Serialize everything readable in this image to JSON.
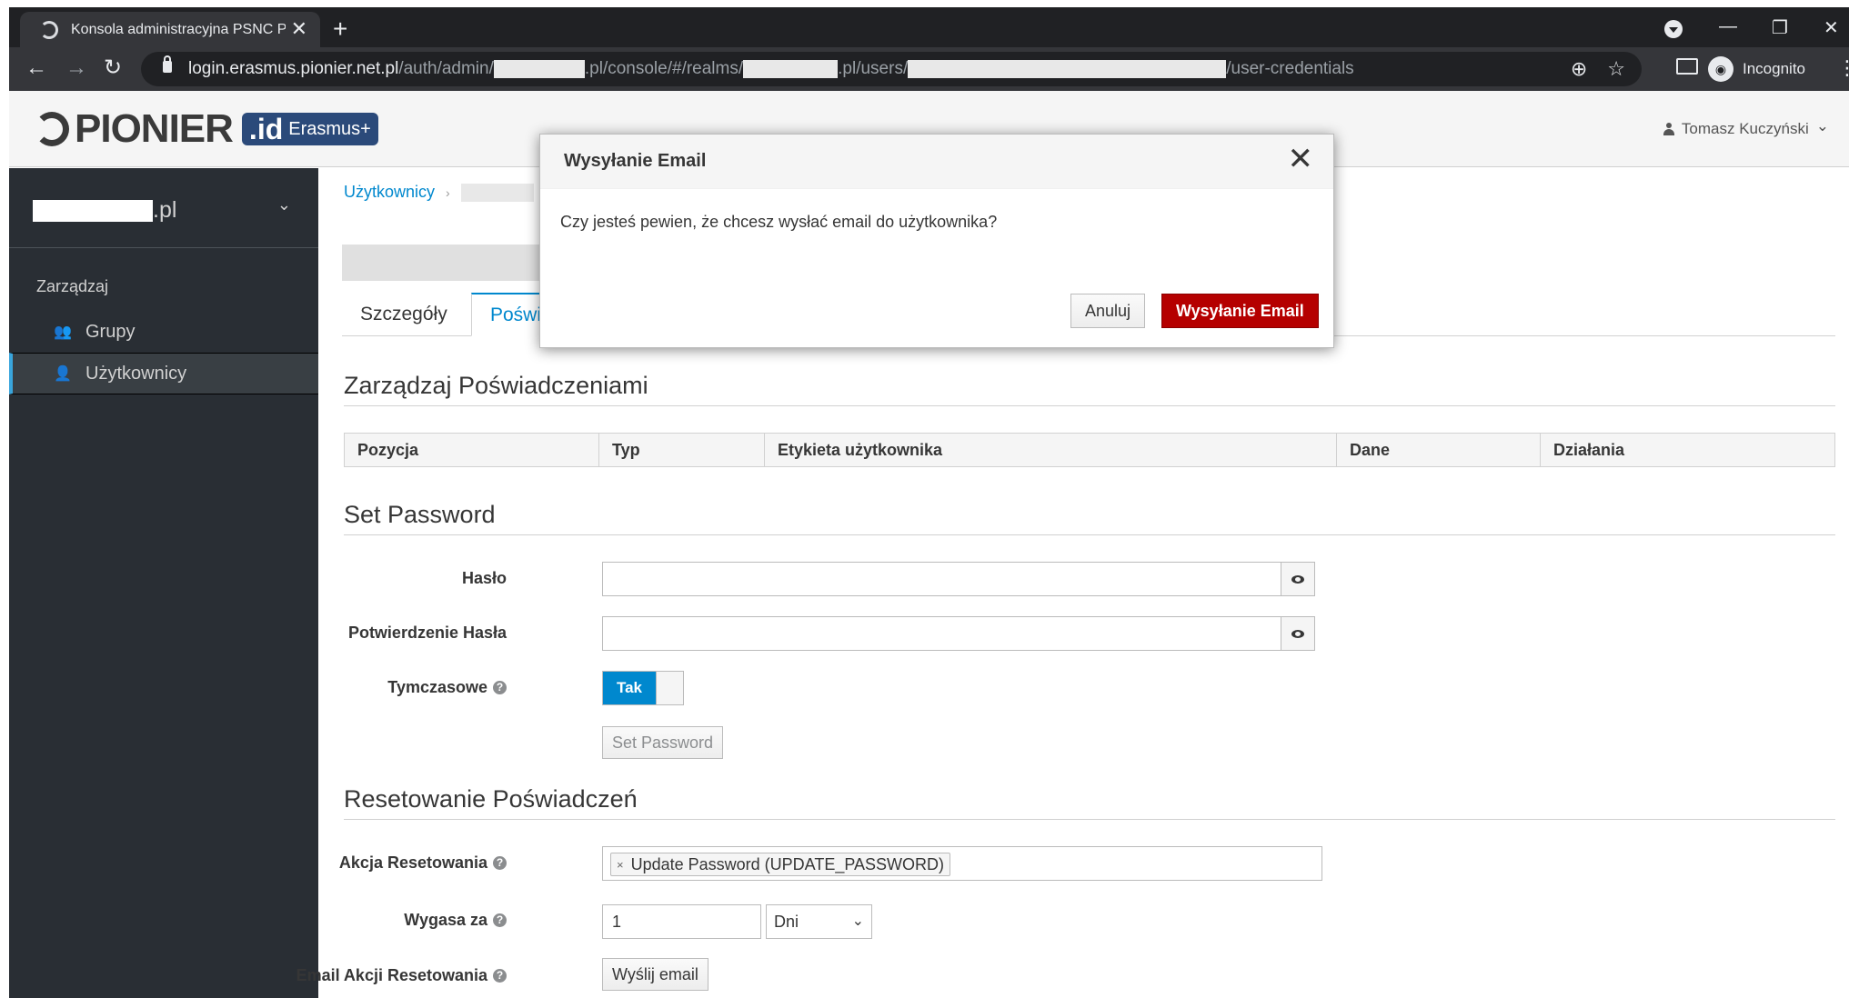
{
  "browser": {
    "tab_title": "Konsola administracyjna PSNC Pa",
    "new_tab": "+",
    "tab_close": "✕",
    "url_host": "login.erasmus.pionier.net.pl",
    "url_part1": "/auth/admin/",
    "url_part2": ".pl/console/#/realms/",
    "url_part3": ".pl/users/",
    "url_part4": "/user-credentials",
    "incognito_label": "Incognito",
    "back_icon": "←",
    "forward_icon": "→",
    "reload_icon": "↻",
    "zoom_icon": "⊕",
    "star_icon": "☆",
    "menu_icon": "⋮",
    "min_icon": "—",
    "restore_icon": "❐",
    "close_icon": "✕"
  },
  "header": {
    "logo_word": "PIONIER",
    "logo_id": ".id",
    "logo_erasmus": "Erasmus+",
    "user_name": "Tomasz Kuczyński",
    "user_chevron": "⌄"
  },
  "sidebar": {
    "realm_suffix": ".pl",
    "realm_chevron": "⌄",
    "section_title": "Zarządzaj",
    "items": [
      {
        "label": "Grupy",
        "icon": "👥"
      },
      {
        "label": "Użytkownicy",
        "icon": "👤"
      }
    ]
  },
  "main": {
    "breadcrumb_users": "Użytkownicy",
    "breadcrumb_sep": "›",
    "tabs": [
      "Szczegóły",
      "Poświ"
    ],
    "manage_title": "Zarządzaj Poświadczeniami",
    "table_headers": [
      "Pozycja",
      "Typ",
      "Etykieta użytkownika",
      "Dane",
      "Działania"
    ],
    "set_password_title": "Set Password",
    "password_label": "Hasło",
    "confirm_label": "Potwierdzenie Hasła",
    "temporary_label": "Tymczasowe",
    "temporary_value": "Tak",
    "set_password_button": "Set Password",
    "reset_title": "Resetowanie Poświadczeń",
    "reset_action_label": "Akcja Resetowania",
    "reset_action_value": "Update Password (UPDATE_PASSWORD)",
    "reset_action_remove": "×",
    "expires_label": "Wygasa za",
    "expires_value": "1",
    "expires_unit": "Dni",
    "email_label": "Email Akcji Resetowania",
    "send_email_button": "Wyślij email",
    "help": "?"
  },
  "modal": {
    "title": "Wysyłanie Email",
    "close": "✕",
    "body": "Czy jesteś pewien, że chcesz wysłać email do użytkownika?",
    "cancel": "Anuluj",
    "confirm": "Wysyłanie Email"
  },
  "colors": {
    "sidebar_bg": "#292e34",
    "accent": "#0088ce",
    "danger": "#b50000"
  }
}
